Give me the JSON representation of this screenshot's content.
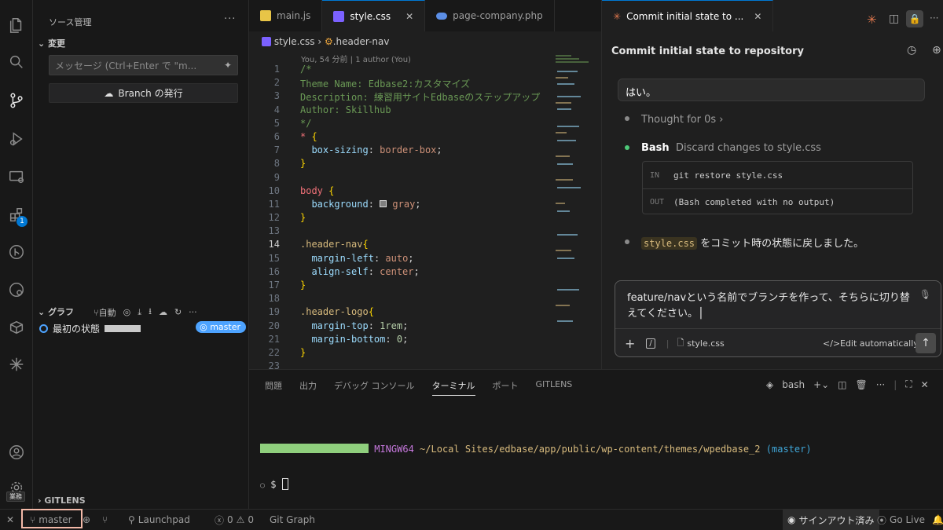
{
  "activity_bar": {
    "items": [
      "explorer-icon",
      "search-icon",
      "source-control-icon",
      "run-debug-icon",
      "remote-explorer-icon",
      "extensions-icon",
      "gitlens-icon",
      "gitlens-inspect-icon",
      "containers-icon",
      "claude-icon"
    ],
    "extensions_badge": "1",
    "bottom_tooltip": "業務"
  },
  "sidebar": {
    "title": "ソース管理",
    "changes_section": "変更",
    "commit_message_placeholder": "メッセージ (Ctrl+Enter で \"m...",
    "publish_button": "Branch の発行",
    "graph_section": "グラフ",
    "graph_auto": "自動",
    "graph_commit": {
      "message": "最初の状態",
      "ref": "master"
    },
    "gitlens_section": "GITLENS"
  },
  "editor_tabs": [
    {
      "label": "main.js",
      "icon_color": "#e8c547",
      "active": false
    },
    {
      "label": "style.css",
      "icon_color": "#7b61ff",
      "active": true
    },
    {
      "label": "page-company.php",
      "icon_color": "#5b8ee6",
      "active": false
    }
  ],
  "editor": {
    "breadcrumb_file": "style.css",
    "breadcrumb_symbol": ".header-nav",
    "blame": "You, 54 分前 | 1 author (You)",
    "current_line": 14
  },
  "claude_panel": {
    "tab_title": "Commit initial state to ...",
    "header": "Commit initial state to repository",
    "user_message": "はい。",
    "thought": "Thought for 0s",
    "tool_name": "Bash",
    "tool_desc": "Discard changes to style.css",
    "in_label": "IN",
    "in_cmd": "git restore style.css",
    "out_label": "OUT",
    "out_text": "(Bash completed with no output)",
    "result_file": "style.css",
    "result_text": "をコミット時の状態に戻しました。",
    "input_text": "feature/navという名前でブランチを作って、そちらに切り替えてください。",
    "attached_file": "style.css",
    "edit_mode": "Edit automatically"
  },
  "panel": {
    "tabs": [
      "問題",
      "出力",
      "デバッグ コンソール",
      "ターミナル",
      "ポート",
      "GITLENS"
    ],
    "active_tab": "ターミナル",
    "shell": "bash",
    "terminal_env": "MINGW64",
    "terminal_path": "~/Local Sites/edbase/app/public/wp-content/themes/wpedbase_2",
    "terminal_branch": "(master)",
    "prompt": "$"
  },
  "status_bar": {
    "branch": "master",
    "launchpad": "Launchpad",
    "errors": "0",
    "warnings": "0",
    "git_graph": "Git Graph",
    "signed_out": "サインアウト済み",
    "go_live": "Go Live"
  },
  "colors": {
    "accent": "#0078d4",
    "ref_badge": "#4da3ff",
    "terminal_user_bar": "#8fcf7d",
    "terminal_env": "#c678dd",
    "terminal_branch": "#3fa6d8",
    "highlight_box": "#f3b9a8"
  }
}
